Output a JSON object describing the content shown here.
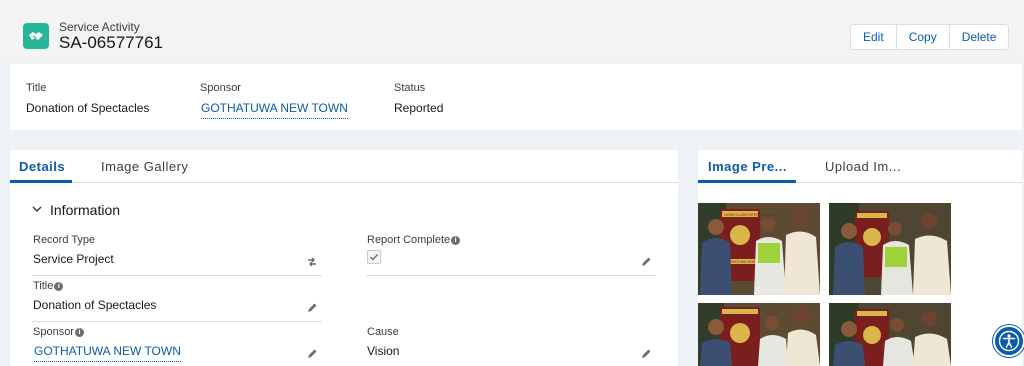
{
  "header": {
    "object_type": "Service Activity",
    "record_name": "SA-06577761",
    "icon": "handshake-icon",
    "icon_color": "#26b79a",
    "actions": {
      "edit": "Edit",
      "copy": "Copy",
      "delete": "Delete"
    }
  },
  "highlights": {
    "title_label": "Title",
    "title_value": "Donation of Spectacles",
    "sponsor_label": "Sponsor",
    "sponsor_value": "GOTHATUWA NEW TOWN",
    "status_label": "Status",
    "status_value": "Reported"
  },
  "main": {
    "tabs": [
      "Details",
      "Image Gallery"
    ],
    "active_tab": "Details",
    "section_title": "Information",
    "fields": {
      "record_type_label": "Record Type",
      "record_type_value": "Service Project",
      "report_complete_label": "Report Complete",
      "report_complete_checked": true,
      "title_label": "Title",
      "title_value": "Donation of Spectacles",
      "sponsor_label": "Sponsor",
      "sponsor_value": "GOTHATUWA NEW TOWN",
      "cause_label": "Cause",
      "cause_value": "Vision"
    }
  },
  "side": {
    "tabs": [
      "Image Pre...",
      "Upload Im..."
    ],
    "active_tab": "Image Pre...",
    "banner_text": "LIONS CLUBS INTERNATIONAL",
    "banner_subtext": "GOTHATUWA NEW TOWN"
  },
  "colors": {
    "accent": "#0b5cab",
    "brand_icon": "#26b79a"
  }
}
